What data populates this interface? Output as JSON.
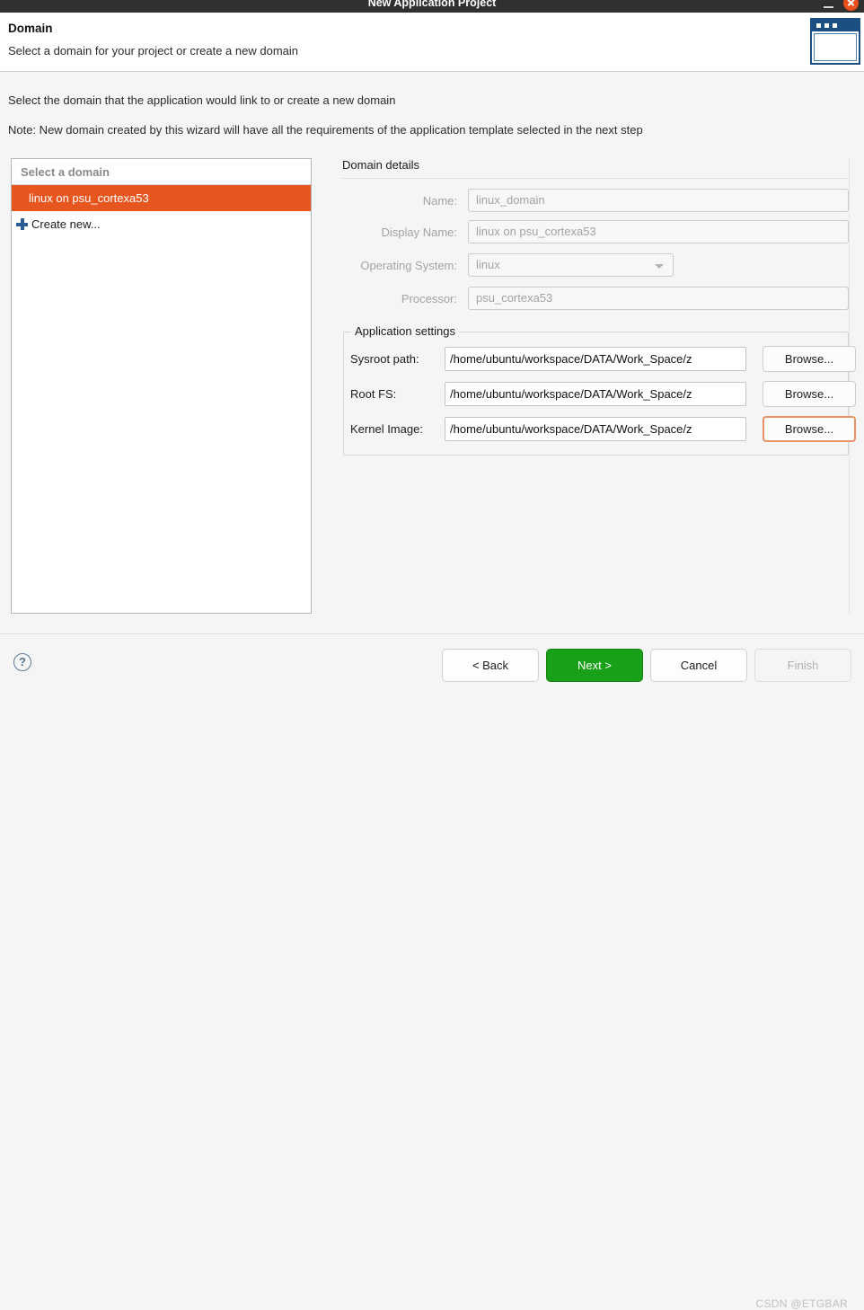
{
  "window": {
    "title": "New Application Project",
    "minimize_label": "",
    "close_label": ""
  },
  "header": {
    "title": "Domain",
    "subtitle": "Select a domain for your project or create a new domain",
    "banner_icon": "wizard-window-icon"
  },
  "intro": {
    "line1": "Select the domain that the application would link to or create a new domain",
    "line2": "Note: New domain created by this wizard will have all the requirements of the application template selected in the next step"
  },
  "domain_list": {
    "header": "Select a domain",
    "items": [
      {
        "label": "linux on psu_cortexa53",
        "selected": true
      }
    ],
    "create_new": "Create new...",
    "create_new_icon": "plus-icon"
  },
  "domain_details": {
    "title": "Domain details",
    "fields": [
      {
        "label": "Name:",
        "value": "linux_domain",
        "type": "text",
        "disabled": true
      },
      {
        "label": "Display Name:",
        "value": "linux on psu_cortexa53",
        "type": "text",
        "disabled": true
      },
      {
        "label": "Operating System:",
        "value": "linux",
        "type": "select",
        "disabled": true
      },
      {
        "label": "Processor:",
        "value": "psu_cortexa53",
        "type": "text",
        "disabled": true
      }
    ]
  },
  "application_settings": {
    "title": "Application settings",
    "rows": [
      {
        "label": "Sysroot path:",
        "value": "/home/ubuntu/workspace/DATA/Work_Space/z",
        "button": "Browse...",
        "focused": false
      },
      {
        "label": "Root FS:",
        "value": "/home/ubuntu/workspace/DATA/Work_Space/z",
        "button": "Browse...",
        "focused": false
      },
      {
        "label": "Kernel Image:",
        "value": "/home/ubuntu/workspace/DATA/Work_Space/z",
        "button": "Browse...",
        "focused": true
      }
    ]
  },
  "footer": {
    "help_icon": "?",
    "buttons": [
      {
        "label": "< Back",
        "style": "normal"
      },
      {
        "label": "Next >",
        "style": "primary"
      },
      {
        "label": "Cancel",
        "style": "normal"
      },
      {
        "label": "Finish",
        "style": "disabled"
      }
    ],
    "watermark": "CSDN @ETGBAR"
  },
  "colors": {
    "selection": "#e8561f",
    "primary_button": "#18a018",
    "banner_icon": "#1b4f82",
    "focus_ring": "#e8926a",
    "close_button": "#e8501c"
  }
}
